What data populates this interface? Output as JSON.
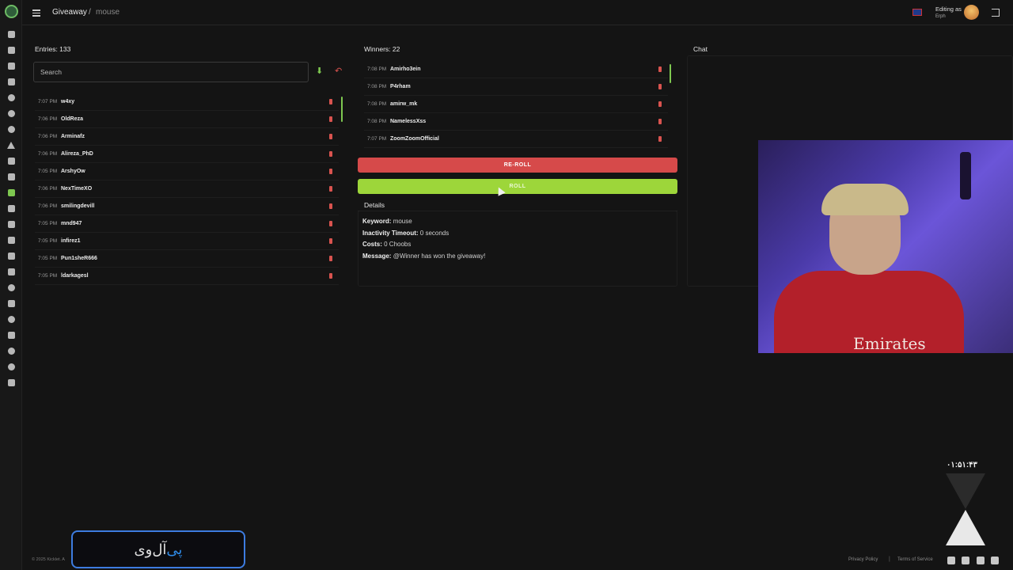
{
  "breadcrumb": {
    "main": "Giveaway",
    "separator": "/",
    "sub": "mouse"
  },
  "header": {
    "editing_label": "Editing as",
    "editing_user": "Erph"
  },
  "entries": {
    "title": "Entries: 133",
    "search_placeholder": "Search",
    "items": [
      {
        "time": "7:07 PM",
        "name": "w4xy"
      },
      {
        "time": "7:06 PM",
        "name": "OldReza"
      },
      {
        "time": "7:06 PM",
        "name": "Arminafz"
      },
      {
        "time": "7:06 PM",
        "name": "Alireza_PhD"
      },
      {
        "time": "7:05 PM",
        "name": "ArshyOw"
      },
      {
        "time": "7:06 PM",
        "name": "NexTimeXO"
      },
      {
        "time": "7:06 PM",
        "name": "smilingdevill"
      },
      {
        "time": "7:05 PM",
        "name": "mnd947"
      },
      {
        "time": "7:05 PM",
        "name": "infirez1"
      },
      {
        "time": "7:05 PM",
        "name": "Pun1sheR666"
      },
      {
        "time": "7:05 PM",
        "name": "ldarkagesl"
      }
    ]
  },
  "winners": {
    "title": "Winners: 22",
    "items": [
      {
        "time": "7:08 PM",
        "name": "Amirho3ein"
      },
      {
        "time": "7:08 PM",
        "name": "P4rham"
      },
      {
        "time": "7:08 PM",
        "name": "amirw_mk"
      },
      {
        "time": "7:08 PM",
        "name": "NamelessXss"
      },
      {
        "time": "7:07 PM",
        "name": "ZoomZoomOfficial"
      }
    ]
  },
  "actions": {
    "reroll_label": "RE-ROLL",
    "roll_label": "ROLL"
  },
  "details": {
    "title": "Details",
    "keyword_label": "Keyword:",
    "keyword_value": "mouse",
    "timeout_label": "Inactivity Timeout:",
    "timeout_value": "0 seconds",
    "costs_label": "Costs:",
    "costs_value": "0 Choobs",
    "message_label": "Message:",
    "message_value": "@Winner has won the giveaway!"
  },
  "chat": {
    "title": "Chat"
  },
  "webcam": {
    "shirt_text": "Emirates"
  },
  "overlay": {
    "timer": "۰۱:۵۱:۴۳",
    "promo_text_main": "آل‌وی",
    "promo_text_accent": "پی"
  },
  "footer": {
    "copyright": "© 2025 Kicklet. A",
    "privacy": "Privacy Policy",
    "separator": "|",
    "terms": "Terms of Service"
  },
  "colors": {
    "accent_green": "#9dd63a",
    "accent_red": "#d64a4a",
    "background": "#141414"
  },
  "icons": [
    "dashboard-icon",
    "file-icon",
    "link-icon",
    "hammer-icon",
    "chat-icon",
    "clock-icon",
    "shield-icon",
    "triangle-icon",
    "music-icon",
    "star-icon",
    "gift-icon",
    "cart-icon",
    "link-icon",
    "chart-icon",
    "video-icon",
    "box-icon",
    "smile-icon",
    "film-icon",
    "chat-icon",
    "monitor-icon",
    "search-icon",
    "discord-icon",
    "wallet-icon"
  ]
}
